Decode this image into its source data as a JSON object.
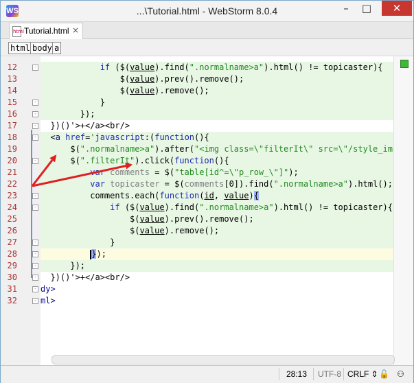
{
  "app": {
    "icon_text": "WS",
    "title": "...\\Tutorial.html - WebStorm 8.0.4",
    "controls": {
      "minimize": "–",
      "maximize": "□",
      "close": "✕"
    }
  },
  "tab": {
    "label": "Tutorial.html",
    "close": "×",
    "file_icon": "html"
  },
  "breadcrumbs": [
    "html",
    "body",
    "a"
  ],
  "status": {
    "position": "28:13",
    "encoding": "UTF-8",
    "line_separator": "CRLF ⇕"
  },
  "colors": {
    "line_number": "#a33333",
    "keyword": "#1d2bb0",
    "string": "#218a21",
    "arrow": "#e02020",
    "current_line_bg": "#fdfbe0",
    "scope_bg": "#e8f6e4"
  },
  "lines": [
    {
      "n": "12",
      "text": "            if ($(value).find(\".normalname>a\").html() != topicaster){"
    },
    {
      "n": "13",
      "text": "                $(value).prev().remove();"
    },
    {
      "n": "14",
      "text": "                $(value).remove();"
    },
    {
      "n": "15",
      "text": "            }"
    },
    {
      "n": "16",
      "text": "        });"
    },
    {
      "n": "17",
      "text": "  })()'>+</a><br/>"
    },
    {
      "n": "18",
      "text": "  <a href='javascript:(function(){"
    },
    {
      "n": "19",
      "text": "      $(\".normalname>a\").after(\"<img class=\\\"filterIt\\\" src=\\\"/style_images/"
    },
    {
      "n": "20",
      "text": "      $(\".filterIt\").click(function(){"
    },
    {
      "n": "21",
      "text": "          var comments = $(\"table[id^=\\\"p_row_\\\"]\");"
    },
    {
      "n": "22",
      "text": "          var topicaster = $(comments[0]).find(\".normalname>a\").html();"
    },
    {
      "n": "23",
      "text": "          comments.each(function(id, value){"
    },
    {
      "n": "24",
      "text": "              if ($(value).find(\".normalname>a\").html() != topicaster){"
    },
    {
      "n": "25",
      "text": "                  $(value).prev().remove();"
    },
    {
      "n": "26",
      "text": "                  $(value).remove();"
    },
    {
      "n": "27",
      "text": "              }"
    },
    {
      "n": "28",
      "text": "          });"
    },
    {
      "n": "29",
      "text": "      });"
    },
    {
      "n": "30",
      "text": "  })()'>+</a><br/>"
    },
    {
      "n": "31",
      "text": "dy>"
    },
    {
      "n": "32",
      "text": "ml>"
    }
  ]
}
